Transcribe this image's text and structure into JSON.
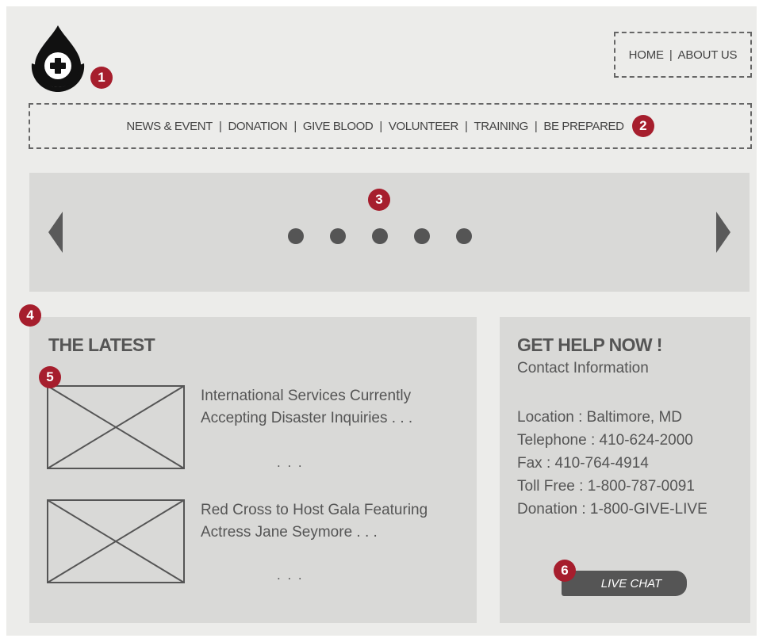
{
  "header": {
    "logo_icon": "blood-drop-cross-icon",
    "top_nav": [
      "HOME",
      "ABOUT US"
    ]
  },
  "main_nav": [
    "NEWS & EVENT",
    "DONATION",
    "GIVE BLOOD",
    "VOLUNTEER",
    "TRAINING",
    "BE PREPARED"
  ],
  "slider": {
    "dot_count": 5,
    "prev_icon": "triangle-left-icon",
    "next_icon": "triangle-right-icon"
  },
  "latest": {
    "heading": "THE LATEST",
    "items": [
      {
        "title_line1": "International Services Currently",
        "title_line2": "Accepting Disaster Inquiries . . .",
        "more": ". . ."
      },
      {
        "title_line1": "Red Cross to Host Gala Featuring",
        "title_line2": "Actress Jane Seymore . . .",
        "more": ". . ."
      }
    ]
  },
  "help": {
    "heading": "GET HELP NOW !",
    "subtitle": "Contact Information",
    "contacts": [
      "Location : Baltimore, MD",
      "Telephone : 410-624-2000",
      "Fax : 410-764-4914",
      "Toll Free : 1-800-787-0091",
      "Donation : 1-800-GIVE-LIVE"
    ],
    "chat_label": "LIVE CHAT"
  },
  "markers": [
    "1",
    "2",
    "3",
    "4",
    "5",
    "6"
  ],
  "colors": {
    "page_bg": "#ececea",
    "panel_bg": "#d9d9d7",
    "marker": "#a61e2d",
    "text": "#555555"
  }
}
